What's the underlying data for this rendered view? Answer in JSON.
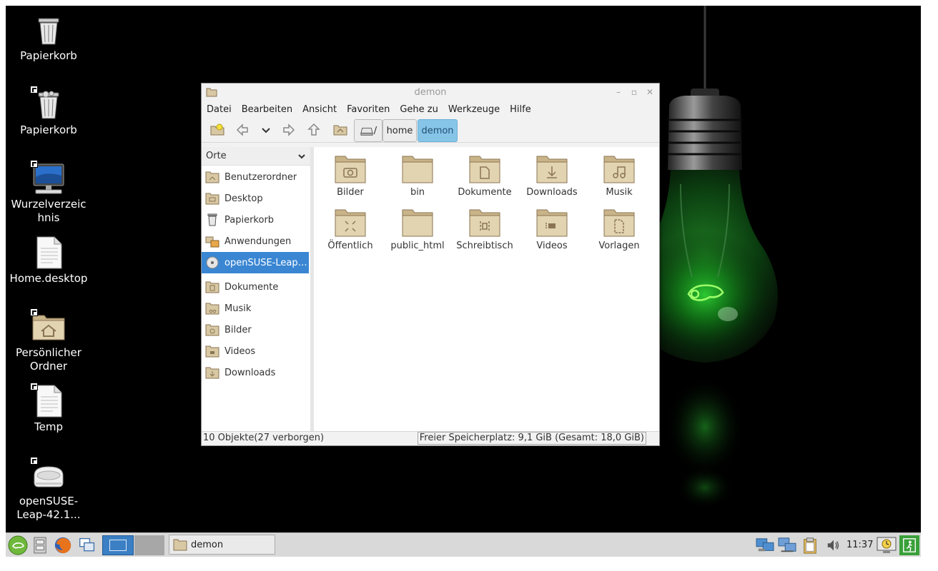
{
  "desktop": {
    "icons": [
      {
        "label": "Papierkorb",
        "icon": "trash-icon"
      },
      {
        "label": "Papierkorb",
        "icon": "trash-full-icon"
      },
      {
        "label": "Wurzelverzeichnis",
        "icon": "computer-icon"
      },
      {
        "label": "Home.desktop",
        "icon": "document-icon"
      },
      {
        "label": "Persönlicher Ordner",
        "icon": "home-folder-icon"
      },
      {
        "label": "Temp",
        "icon": "document-icon"
      },
      {
        "label": "openSUSE-Leap-42.1...",
        "icon": "optical-drive-icon"
      }
    ]
  },
  "window": {
    "title": "demon",
    "buttons": {
      "minimize": "–",
      "maximize": "▫",
      "close": "✕"
    },
    "menu": [
      "Datei",
      "Bearbeiten",
      "Ansicht",
      "Favoriten",
      "Gehe zu",
      "Werkzeuge",
      "Hilfe"
    ],
    "path": {
      "root": "/",
      "crumbs": [
        "home",
        "demon"
      ]
    },
    "sidebar": {
      "header": "Orte",
      "items": [
        {
          "label": "Benutzerordner",
          "icon": "home-folder-icon"
        },
        {
          "label": "Desktop",
          "icon": "desktop-folder-icon"
        },
        {
          "label": "Papierkorb",
          "icon": "trash-icon"
        },
        {
          "label": "Anwendungen",
          "icon": "applications-icon"
        },
        {
          "label": "openSUSE-Leap-42.1...",
          "icon": "optical-disc-icon",
          "selected": true
        },
        {
          "label": "Dokumente",
          "icon": "documents-folder-icon"
        },
        {
          "label": "Musik",
          "icon": "music-folder-icon"
        },
        {
          "label": "Bilder",
          "icon": "pictures-folder-icon"
        },
        {
          "label": "Videos",
          "icon": "videos-folder-icon"
        },
        {
          "label": "Downloads",
          "icon": "downloads-folder-icon"
        }
      ]
    },
    "files": [
      {
        "name": "Bilder",
        "icon": "pictures-folder-icon"
      },
      {
        "name": "bin",
        "icon": "folder-icon"
      },
      {
        "name": "Dokumente",
        "icon": "documents-folder-icon"
      },
      {
        "name": "Downloads",
        "icon": "downloads-folder-icon"
      },
      {
        "name": "Musik",
        "icon": "music-folder-icon"
      },
      {
        "name": "Öffentlich",
        "icon": "public-folder-icon"
      },
      {
        "name": "public_html",
        "icon": "folder-icon"
      },
      {
        "name": "Schreibtisch",
        "icon": "desktop-folder-icon"
      },
      {
        "name": "Videos",
        "icon": "videos-folder-icon"
      },
      {
        "name": "Vorlagen",
        "icon": "templates-folder-icon"
      }
    ],
    "status": {
      "left": "10 Objekte(27 verborgen)",
      "right": "Freier Speicherplatz: 9,1 GiB (Gesamt: 18,0 GiB)"
    }
  },
  "taskbar": {
    "task": "demon",
    "clock": "11:37"
  },
  "colors": {
    "folder": "#d8c8a4",
    "selection": "#3a86d3",
    "crumb_active": "#87c5e8",
    "bulb_glow": "#22c02a"
  }
}
